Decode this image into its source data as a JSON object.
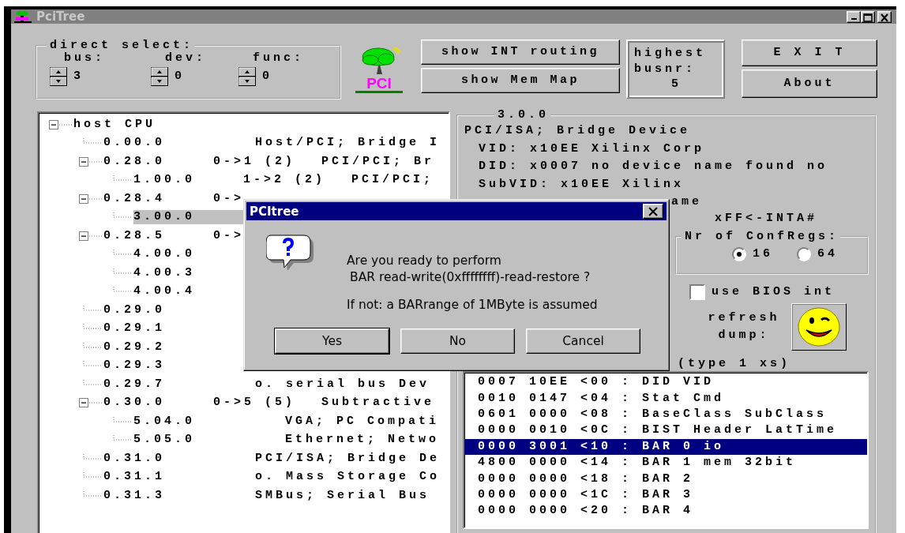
{
  "window": {
    "title": "PciTree"
  },
  "direct_select": {
    "label": "direct select:",
    "fields": [
      {
        "label": "bus:",
        "value": "3"
      },
      {
        "label": "dev:",
        "value": "0"
      },
      {
        "label": "func:",
        "value": "0"
      }
    ]
  },
  "logo": {
    "text": "PCI"
  },
  "view_buttons": [
    "show INT routing",
    "show Mem Map"
  ],
  "highest_busnr": {
    "label": "highest busnr:",
    "value": "5"
  },
  "main_buttons": [
    "E X I T",
    "About"
  ],
  "tree": {
    "label": "host CPU",
    "expanded": true,
    "children": [
      {
        "address": "0.00.0",
        "description": "Host/PCI; Bridge I",
        "selected": false
      },
      {
        "address": "0.28.0",
        "range": "0->1 (2)",
        "description": "PCI/PCI; Br",
        "expanded": true,
        "selected": false,
        "children": [
          {
            "address": "1.00.0",
            "range": "1->2 (2)",
            "description": "PCI/PCI;",
            "selected": false
          }
        ]
      },
      {
        "address": "0.28.4",
        "range": "0->",
        "expanded": true,
        "selected": false,
        "children": [
          {
            "address": "3.00.0",
            "selected": true
          }
        ]
      },
      {
        "address": "0.28.5",
        "range": "0->",
        "expanded": true,
        "selected": false,
        "children": [
          {
            "address": "4.00.0",
            "selected": false
          },
          {
            "address": "4.00.3",
            "selected": false
          },
          {
            "address": "4.00.4",
            "selected": false
          }
        ]
      },
      {
        "address": "0.29.0",
        "selected": false
      },
      {
        "address": "0.29.1",
        "selected": false
      },
      {
        "address": "0.29.2",
        "selected": false
      },
      {
        "address": "0.29.3",
        "selected": false
      },
      {
        "address": "0.29.7",
        "description": "o. serial bus Dev",
        "selected": false
      },
      {
        "address": "0.30.0",
        "range": "0->5 (5)",
        "description": "Subtractive",
        "expanded": true,
        "selected": false,
        "children": [
          {
            "address": "5.04.0",
            "description": "VGA; PC Compati",
            "selected": false
          },
          {
            "address": "5.05.0",
            "description": "Ethernet; Netwo",
            "selected": false
          }
        ]
      },
      {
        "address": "0.31.0",
        "description": "PCI/ISA; Bridge De",
        "selected": false
      },
      {
        "address": "0.31.1",
        "description": "o. Mass Storage Co",
        "selected": false
      },
      {
        "address": "0.31.3",
        "description": "SMBus; Serial Bus",
        "selected": false
      }
    ]
  },
  "device": {
    "title": "3.0.0",
    "class_line": "PCI/ISA; Bridge Device",
    "id_lines": [
      "VID: x10EE Xilinx Corp",
      "DID: x0007 no device name found no",
      "SubVID: x10EE Xilinx"
    ],
    "partial_line": "ame",
    "interrupt_line": "xFF<-INTA#",
    "conf_regs": {
      "label": "Nr of ConfRegs:",
      "options": [
        {
          "label": "16",
          "selected": true
        },
        {
          "label": "64",
          "selected": false
        }
      ]
    },
    "bios_int": {
      "label": "use BIOS int",
      "checked": false
    },
    "refresh": {
      "label": "refresh dump:"
    },
    "dump": {
      "label": "(type 1 xs)",
      "rows": [
        {
          "text": "0007 10EE <00 : DID VID",
          "selected": false
        },
        {
          "text": "0010 0147 <04 : Stat Cmd",
          "selected": false
        },
        {
          "text": "0601 0000 <08 : BaseClass SubClass",
          "selected": false
        },
        {
          "text": "0000 0010 <0C : BIST Header LatTime",
          "selected": false
        },
        {
          "text": "0000 3001 <10 : BAR 0 io",
          "selected": true
        },
        {
          "text": "4800 0000 <14 : BAR 1 mem 32bit",
          "selected": false
        },
        {
          "text": "0000 0000 <18 : BAR 2",
          "selected": false
        },
        {
          "text": "0000 0000 <1C : BAR 3",
          "selected": false
        },
        {
          "text": "0000 0000 <20 : BAR 4",
          "selected": false
        }
      ]
    }
  },
  "dialog": {
    "title": "PCItree",
    "message": [
      "Are you ready to perform",
      "BAR read-write(0xffffffff)-read-restore ?"
    ],
    "note": "If not: a BARrange of 1MByte is assumed",
    "buttons": [
      {
        "label": "Yes",
        "default": true
      },
      {
        "label": "No",
        "default": false
      },
      {
        "label": "Cancel",
        "default": false
      }
    ]
  }
}
